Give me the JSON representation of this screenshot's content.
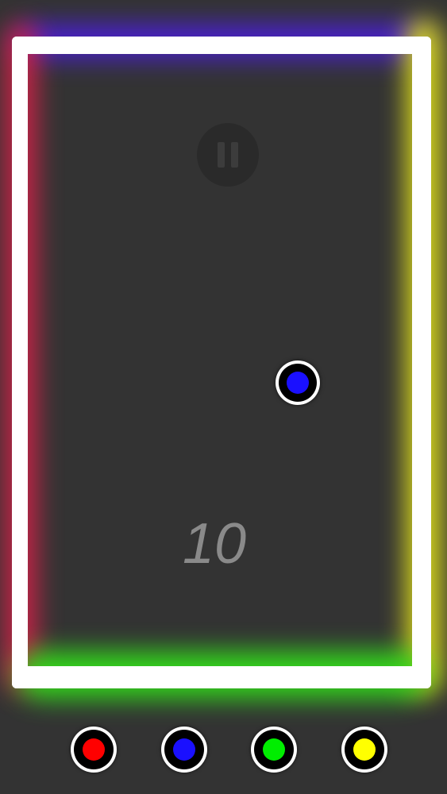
{
  "game": {
    "score": "10",
    "ball": {
      "color": "#1a10ff"
    }
  },
  "walls": {
    "top_glow": "#4a1fd6",
    "left_glow": "#e0204a",
    "right_glow": "#e8e81a",
    "bottom_glow": "#33e01a",
    "wall_color": "#ffffff"
  },
  "controls": {
    "pause_icon": "pause-icon",
    "colors": [
      {
        "name": "red",
        "hex": "#ff0000"
      },
      {
        "name": "blue",
        "hex": "#1a10ff"
      },
      {
        "name": "green",
        "hex": "#00ee00"
      },
      {
        "name": "yellow",
        "hex": "#ffff00"
      }
    ]
  }
}
